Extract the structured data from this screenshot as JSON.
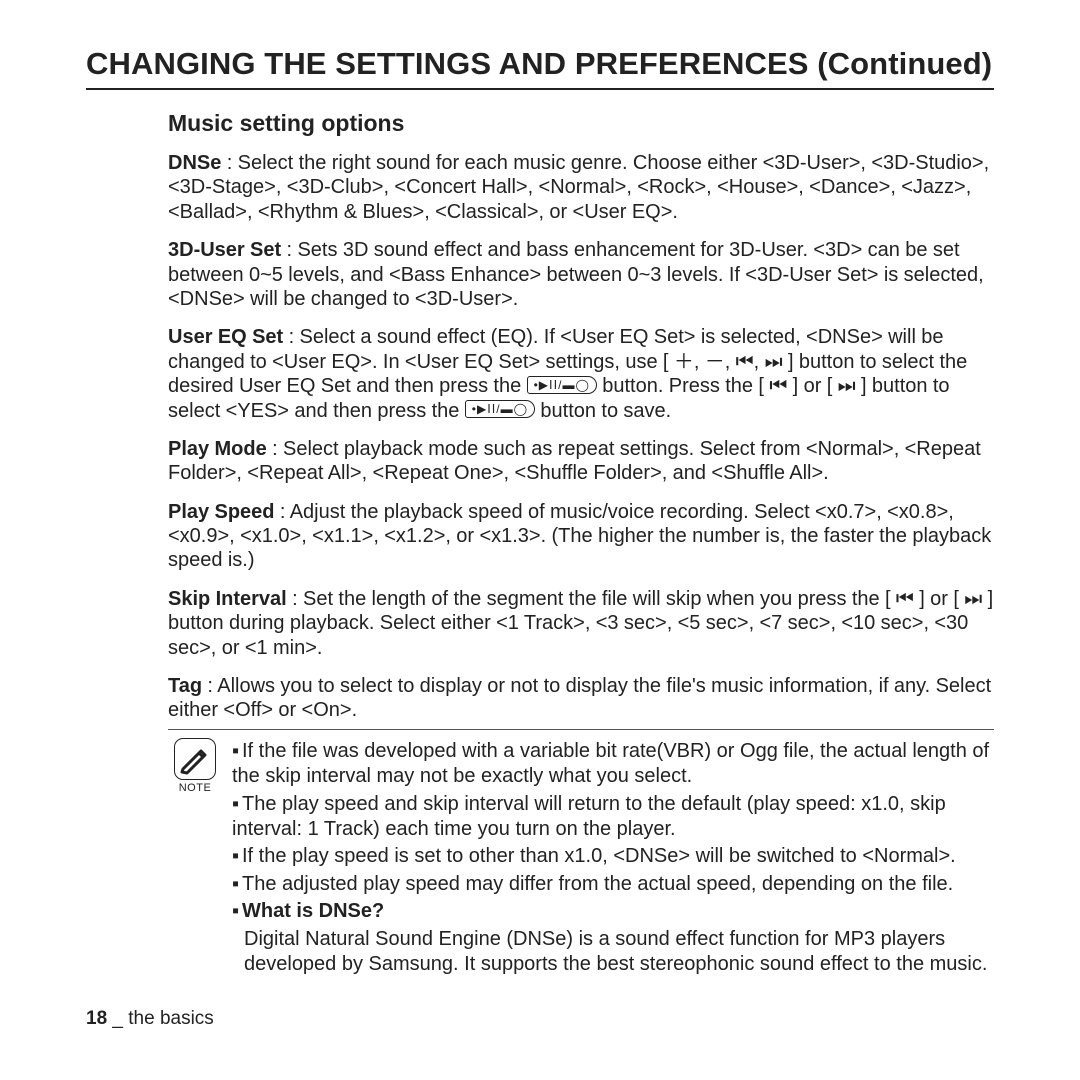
{
  "title": "CHANGING THE SETTINGS AND PREFERENCES (Continued)",
  "subheading": "Music setting options",
  "dnse": {
    "label": "DNSe",
    "text": " : Select the right sound for each music genre. Choose either <3D-User>, <3D-Studio>, <3D-Stage>, <3D-Club>, <Concert Hall>, <Normal>, <Rock>, <House>, <Dance>, <Jazz>, <Ballad>, <Rhythm & Blues>, <Classical>, or <User EQ>."
  },
  "user3d": {
    "label": "3D-User Set",
    "text": " : Sets 3D sound effect and bass enhancement for 3D-User. <3D> can be set between 0~5 levels, and <Bass Enhance> between 0~3 levels. If <3D-User Set> is selected, <DNSe> will be changed to <3D-User>."
  },
  "usereq": {
    "label": "User EQ Set",
    "pre": " : Select a sound effect (EQ). If <User EQ Set> is selected, <DNSe> will be changed to <User EQ>. In <User EQ Set> settings, use [ ＋, －, ⏮, ⏭ ] button to select the desired User EQ Set and then press the ",
    "mid": " button. Press the [ ⏮ ] or [ ⏭ ] button to select <YES> and then press the ",
    "post": " button to save."
  },
  "playmode": {
    "label": "Play Mode",
    "text": " : Select playback mode such as repeat settings. Select from <Normal>, <Repeat Folder>, <Repeat All>, <Repeat One>, <Shuffle Folder>, and <Shuffle All>."
  },
  "playspeed": {
    "label": "Play Speed",
    "text": " : Adjust the playback speed of music/voice recording. Select <x0.7>, <x0.8>, <x0.9>, <x1.0>, <x1.1>, <x1.2>, or <x1.3>. (The higher the number is, the faster the playback speed is.)"
  },
  "skip": {
    "label": "Skip Interval",
    "text": " : Set the length of the segment the file will skip when you press the [ ⏮ ] or [ ⏭ ] button during playback. Select either <1 Track>, <3 sec>, <5 sec>, <7 sec>, <10 sec>, <30 sec>, or <1 min>."
  },
  "tag": {
    "label": "Tag",
    "text": " : Allows you to select to display or not to display the file's music information, if any. Select either <Off> or <On>."
  },
  "noteLabel": "NOTE",
  "notes": {
    "n1": "If the file was developed with a variable bit rate(VBR) or Ogg file, the actual length of the skip interval may not be exactly what you select.",
    "n2": "The play speed and skip interval will return to the default (play speed: x1.0, skip interval: 1 Track) each time you turn on the player.",
    "n3": "If the play speed is set to other than x1.0, <DNSe> will be switched to <Normal>.",
    "n4": "The adjusted play speed may differ from the actual speed, depending on the file.",
    "q": "What is DNSe?",
    "ans": "Digital Natural Sound Engine (DNSe) is a sound effect function for MP3 players developed by Samsung. It supports the best stereophonic sound effect to the music."
  },
  "button_glyph": "•▶ⅠⅠ/▬◯",
  "footer": {
    "page": "18",
    "section": " _ the basics"
  }
}
